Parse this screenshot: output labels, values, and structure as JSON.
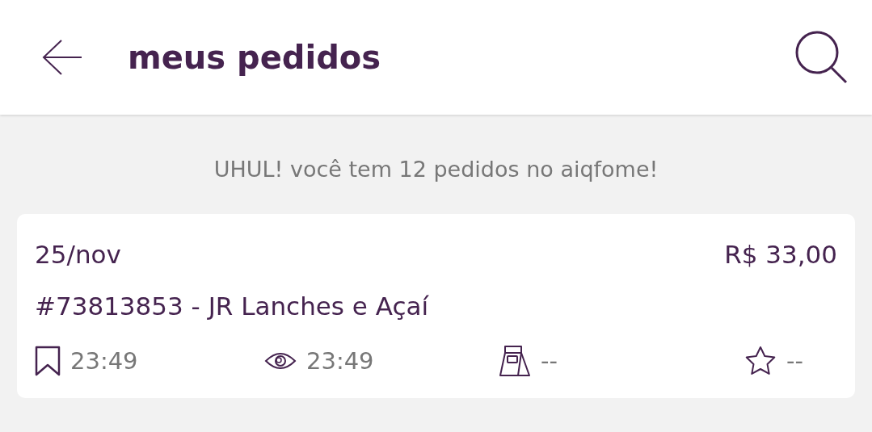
{
  "header": {
    "title": "meus pedidos"
  },
  "summary": "UHUL! você tem 12 pedidos no aiqfome!",
  "orders": [
    {
      "date": "25/nov",
      "price": "R$ 33,00",
      "title": "#73813853 - JR Lanches e Açaí",
      "stats": [
        {
          "kind": "bookmark",
          "value": "23:49"
        },
        {
          "kind": "eye",
          "value": "23:49"
        },
        {
          "kind": "bag",
          "value": "--"
        },
        {
          "kind": "star",
          "value": "--"
        }
      ]
    }
  ]
}
